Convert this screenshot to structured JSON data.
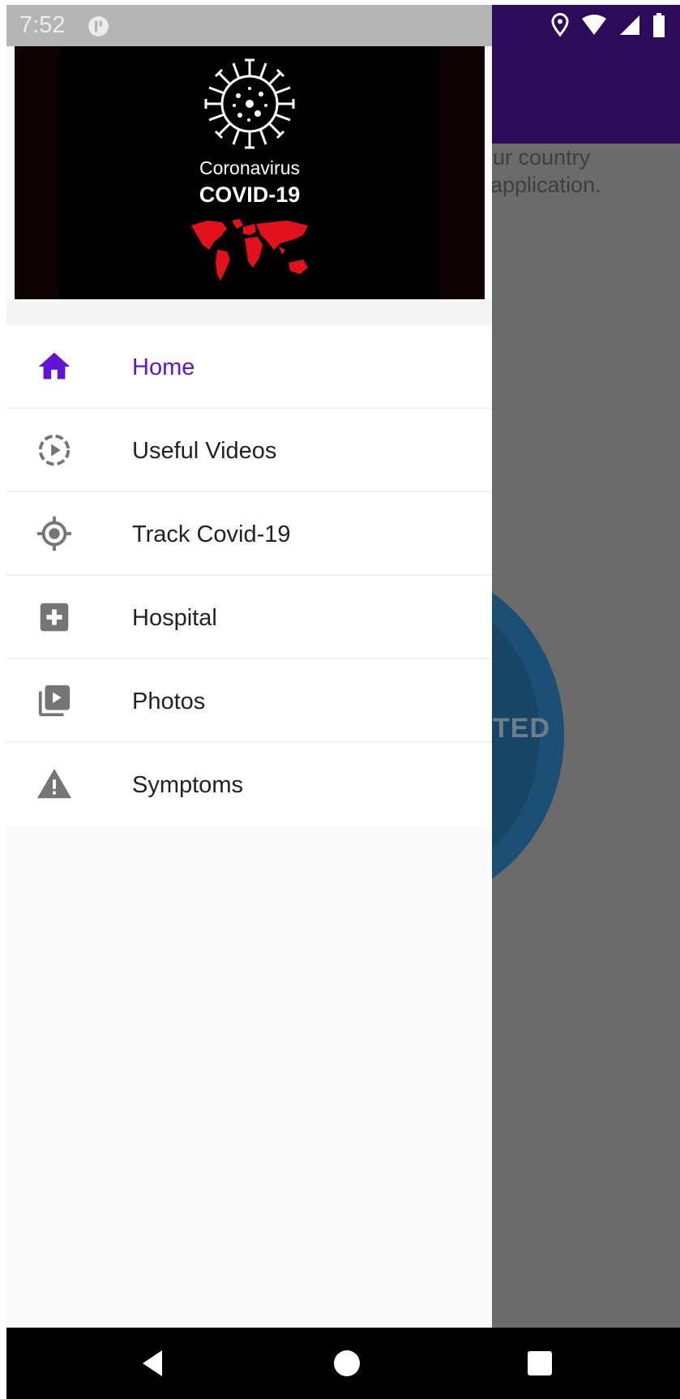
{
  "status_bar": {
    "time": "7:52",
    "icons": [
      "app-notification-icon",
      "location-icon",
      "wifi-icon",
      "signal-icon",
      "battery-icon"
    ]
  },
  "background_app": {
    "text_line_1": "our country",
    "text_line_2": "application.",
    "button_text": "TED",
    "app_bar_color": "#2b0b5a"
  },
  "drawer": {
    "header": {
      "subtitle": "Coronavirus",
      "title": "COVID-19"
    },
    "items": [
      {
        "label": "Home",
        "icon": "home-icon",
        "active": true
      },
      {
        "label": "Useful Videos",
        "icon": "play-circle-icon",
        "active": false
      },
      {
        "label": "Track Covid-19",
        "icon": "gps-target-icon",
        "active": false
      },
      {
        "label": "Hospital",
        "icon": "hospital-icon",
        "active": false
      },
      {
        "label": "Photos",
        "icon": "video-library-icon",
        "active": false
      },
      {
        "label": "Symptoms",
        "icon": "warning-icon",
        "active": false
      }
    ]
  },
  "colors": {
    "accent": "#6214d4",
    "icon_gray": "#757575",
    "map_red": "#e3111b"
  },
  "nav_bar": {
    "buttons": [
      "back-icon",
      "home-circle-icon",
      "recents-icon"
    ]
  }
}
